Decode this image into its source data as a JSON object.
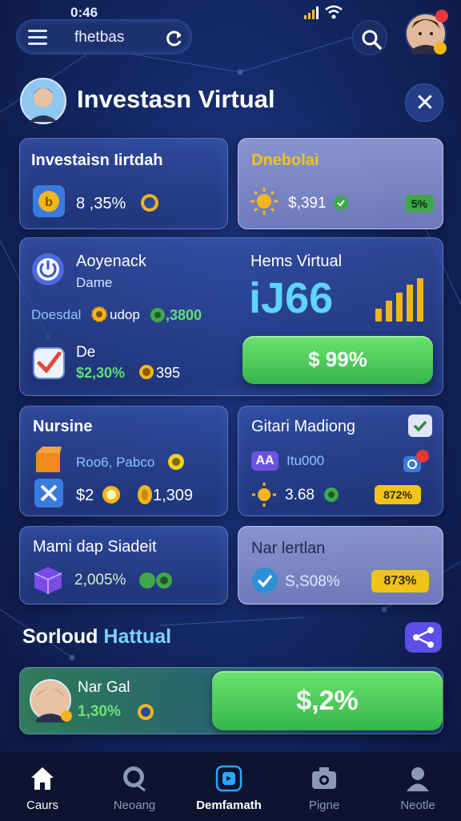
{
  "status_bar": {
    "time": "0:46"
  },
  "top_bar": {
    "search_text": "fhetbas"
  },
  "header": {
    "title": "Investasn Virtual"
  },
  "cards": {
    "investasi": {
      "title": "Investaisn Iirtdah",
      "value": "8 ,35%"
    },
    "dnebolai": {
      "title": "Dnebolai",
      "value": "$,391",
      "badge": "5%"
    },
    "main": {
      "name": "Aoyenack",
      "sub": "Dame",
      "row_label": "Doesdal",
      "row_mid": "udop",
      "row_value": ",3800",
      "check_label": "De",
      "check_value": "$2,30%",
      "check_extra": "395",
      "right_title": "Hems Virtual",
      "big_number": "iJ66",
      "button_label": "$ 99%"
    },
    "nursing": {
      "title": "Nursine",
      "line1": "Roo6, Pabco",
      "amount1": "$2",
      "amount2": "1,309"
    },
    "gitari": {
      "title": "Gitari Madiong",
      "ad": "AA",
      "line1": "Itu000",
      "value": "3.68",
      "badge": "872%"
    },
    "mamidap": {
      "title": "Mami dap Siadeit",
      "value": "2,005%"
    },
    "nar": {
      "title": "Nar lertlan",
      "value": "S,S08%",
      "badge": "873%"
    }
  },
  "section": {
    "title_part1": "Sorloud",
    "title_part2": "Hattual"
  },
  "bottom_card": {
    "name": "Nar Gal",
    "value": "1,30%",
    "button_label": "$,2%"
  },
  "nav": {
    "items": [
      {
        "label": "Caurs",
        "icon": "home-icon",
        "active": false
      },
      {
        "label": "Neoang",
        "icon": "chat-search-icon",
        "active": false
      },
      {
        "label": "Demfamath",
        "icon": "wallet-icon",
        "active": true
      },
      {
        "label": "Pigne",
        "icon": "camera-icon",
        "active": false
      },
      {
        "label": "Neotle",
        "icon": "profile-icon",
        "active": false
      }
    ]
  },
  "colors": {
    "accent_green": "#45c755",
    "accent_gold": "#f2b51c",
    "accent_cyan": "#5fd4ff",
    "badge_green": "#3fa84a",
    "badge_yellow": "#f0c419",
    "nav_active": "#ffffff"
  }
}
